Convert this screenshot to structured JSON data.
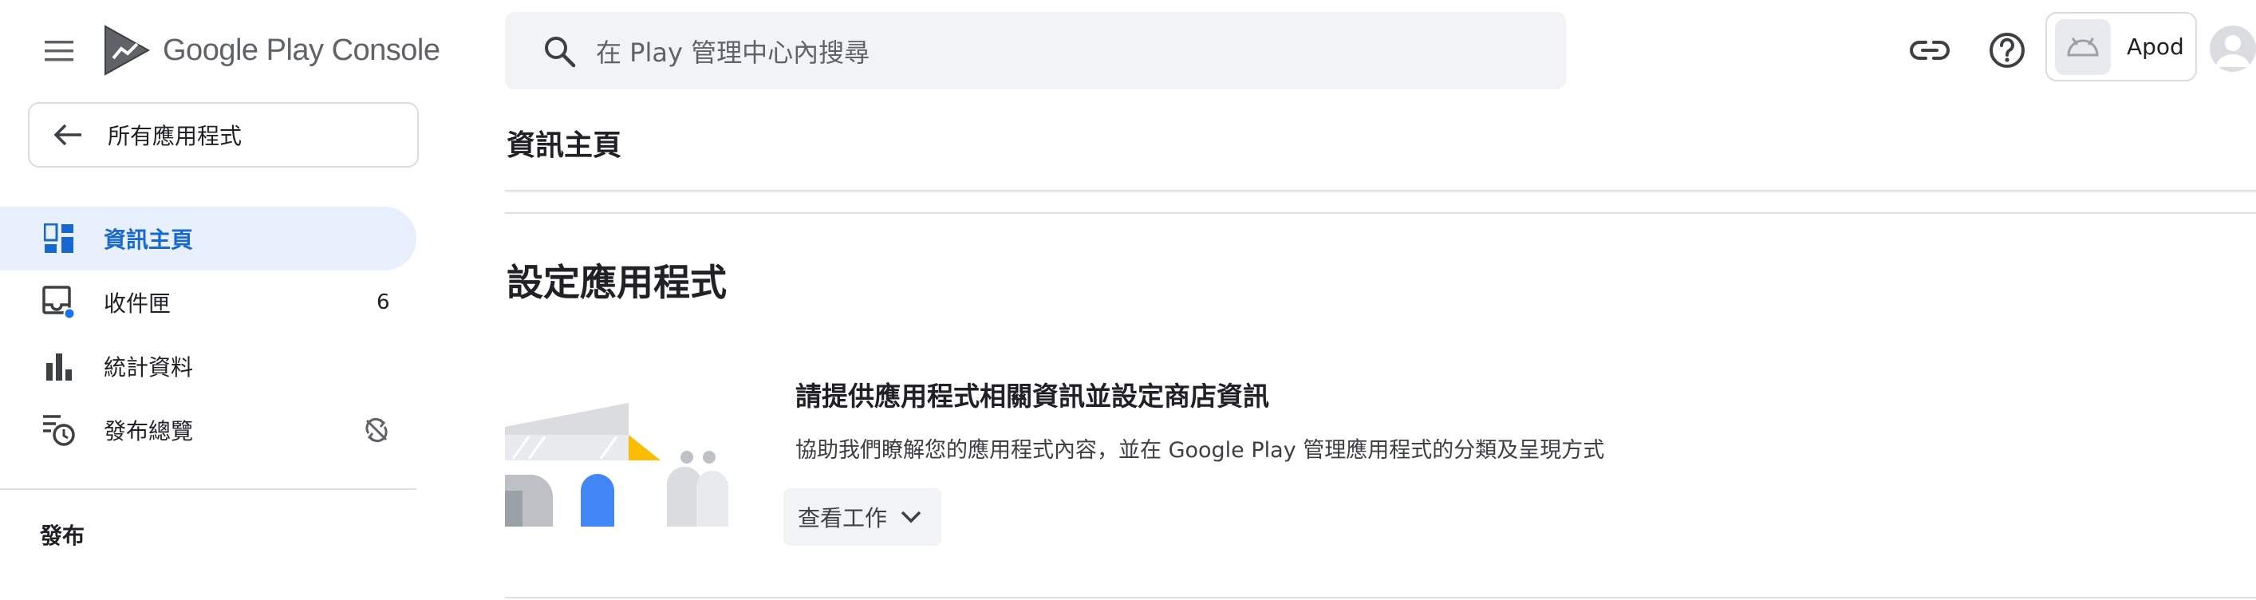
{
  "header": {
    "menu_icon": "hamburger-menu-icon",
    "logo_google_play": "Google Play",
    "logo_console": "Console",
    "search_placeholder": "在 Play 管理中心內搜尋",
    "link_icon": "link-icon",
    "help_icon": "help-circle-icon",
    "app_name": "Apod",
    "app_icon": "android-icon",
    "account_icon": "account-avatar-icon"
  },
  "sidebar": {
    "back_label": "所有應用程式",
    "items": [
      {
        "label": "資訊主頁",
        "icon": "dashboard-icon",
        "active": true
      },
      {
        "label": "收件匣",
        "icon": "inbox-icon",
        "count": "6"
      },
      {
        "label": "統計資料",
        "icon": "bar-chart-icon"
      },
      {
        "label": "發布總覽",
        "icon": "publishing-overview-icon",
        "trailing_icon": "sync-disabled-icon"
      }
    ],
    "section_header": "發布"
  },
  "main": {
    "page_title": "資訊主頁",
    "setup_title": "設定應用程式",
    "card": {
      "title": "請提供應用程式相關資訊並設定商店資訊",
      "description": "協助我們瞭解您的應用程式內容，並在 Google Play 管理應用程式的分類及呈現方式",
      "view_tasks_label": "查看工作"
    }
  },
  "colors": {
    "accent": "#1967d2",
    "active_bg": "#e8f0fe",
    "search_bg": "#f1f3f4",
    "notification_dot": "#1a73e8"
  }
}
